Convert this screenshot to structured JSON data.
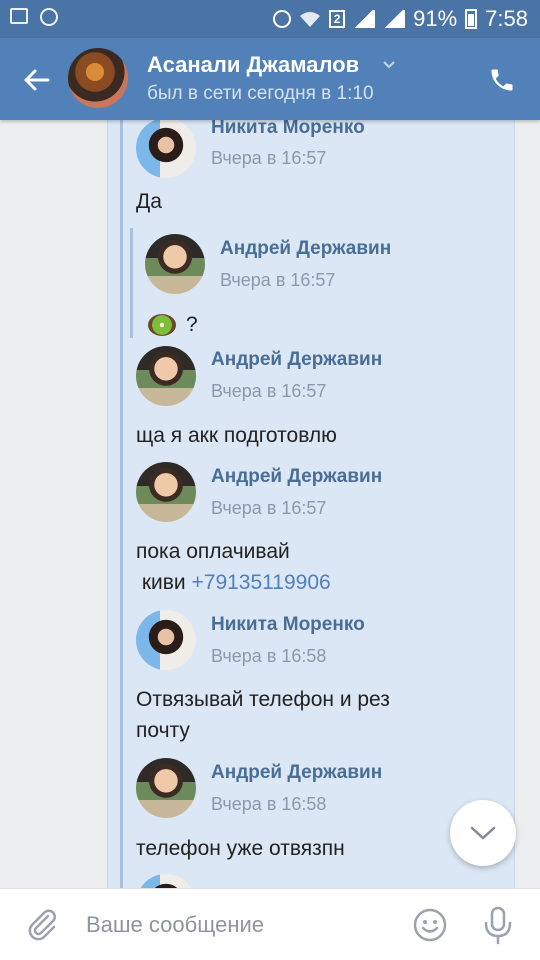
{
  "status_bar": {
    "battery": "91%",
    "time": "7:58",
    "sim_badge": "2",
    "icons": [
      "gallery-icon",
      "settings-badge-icon",
      "alarm-icon",
      "wifi-icon",
      "signal-icon",
      "battery-icon"
    ]
  },
  "header": {
    "name": "Асанали Джамалов",
    "status": "был в сети сегодня в 1:10",
    "icons": [
      "back-arrow-icon",
      "chevron-down-icon",
      "phone-icon"
    ]
  },
  "messages": [
    {
      "author": "Никита Моренко",
      "time": "Вчера в 16:57",
      "text": "Да"
    },
    {
      "author": "Андрей Державин",
      "time": "Вчера в 16:57",
      "text": "?",
      "emoji": "kiwi"
    },
    {
      "author": "Андрей Державин",
      "time": "Вчера в 16:57",
      "text": "ща я акк подготовлю"
    },
    {
      "author": "Андрей Державин",
      "time": "Вчера в 16:57",
      "text_line1": "пока оплачивай",
      "text_line2_prefix": "киви",
      "link": "+79135119906"
    },
    {
      "author": "Никита Моренко",
      "time": "Вчера в 16:58",
      "text_line1": "Отвязывай телефон и рез",
      "text_line2": "почту"
    },
    {
      "author": "Андрей Державин",
      "time": "Вчера в 16:58",
      "text": "телефон уже отвязпн"
    }
  ],
  "composer": {
    "placeholder": "Ваше сообщение",
    "icons": [
      "paperclip-icon",
      "smile-icon",
      "microphone-icon"
    ]
  },
  "colors": {
    "header": "#5181b8",
    "status_bar": "#4a74a5",
    "message_bg": "#dbe7f5",
    "author": "#4a6d96",
    "link": "#4f7fbf"
  }
}
